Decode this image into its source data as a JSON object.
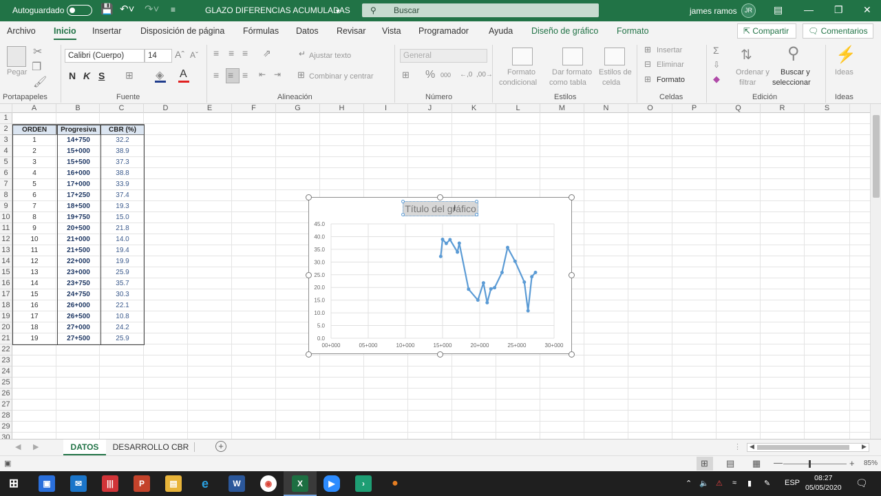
{
  "titlebar": {
    "autosave": "Autoguardado",
    "doc_title": "GLAZO DIFERENCIAS ACUMULADAS",
    "search_placeholder": "Buscar",
    "user_name": "james ramos",
    "user_initials": "JR"
  },
  "ribbon_tabs": [
    {
      "label": "Archivo"
    },
    {
      "label": "Inicio"
    },
    {
      "label": "Insertar"
    },
    {
      "label": "Disposición de página"
    },
    {
      "label": "Fórmulas"
    },
    {
      "label": "Datos"
    },
    {
      "label": "Revisar"
    },
    {
      "label": "Vista"
    },
    {
      "label": "Programador"
    },
    {
      "label": "Ayuda"
    },
    {
      "label": "Diseño de gráfico"
    },
    {
      "label": "Formato"
    }
  ],
  "share_label": "Compartir",
  "comments_label": "Comentarios",
  "ribbon": {
    "paste": "Pegar",
    "font_name": "Calibri (Cuerpo)",
    "font_size": "14",
    "bold": "N",
    "italic": "K",
    "underline": "S",
    "wrap_text": "Ajustar texto",
    "merge_center": "Combinar y centrar",
    "number_format": "General",
    "cond_format_1": "Formato",
    "cond_format_2": "condicional",
    "table_format_1": "Dar formato",
    "table_format_2": "como tabla",
    "cell_styles_1": "Estilos de",
    "cell_styles_2": "celda",
    "insert": "Insertar",
    "delete": "Eliminar",
    "format": "Formato",
    "sort_1": "Ordenar y",
    "sort_2": "filtrar",
    "find_1": "Buscar y",
    "find_2": "seleccionar",
    "ideas": "Ideas",
    "groups": {
      "clipboard": "Portapapeles",
      "font": "Fuente",
      "alignment": "Alineación",
      "number": "Número",
      "styles": "Estilos",
      "cells": "Celdas",
      "editing": "Edición",
      "ideas": "Ideas"
    }
  },
  "columns": [
    "A",
    "B",
    "C",
    "D",
    "E",
    "F",
    "G",
    "H",
    "I",
    "J",
    "K",
    "L",
    "M",
    "N",
    "O",
    "P",
    "Q",
    "R",
    "S"
  ],
  "rows": [
    "1",
    "2",
    "3",
    "4",
    "5",
    "6",
    "7",
    "8",
    "9",
    "10",
    "11",
    "12",
    "13",
    "14",
    "15",
    "16",
    "17",
    "18",
    "19",
    "20",
    "21",
    "22",
    "23",
    "24",
    "25",
    "26",
    "27",
    "28",
    "29",
    "30"
  ],
  "table": {
    "headers": [
      "ORDEN",
      "Progresiva",
      "CBR (%)"
    ],
    "rows": [
      [
        "1",
        "14+750",
        "32.2"
      ],
      [
        "2",
        "15+000",
        "38.9"
      ],
      [
        "3",
        "15+500",
        "37.3"
      ],
      [
        "4",
        "16+000",
        "38.8"
      ],
      [
        "5",
        "17+000",
        "33.9"
      ],
      [
        "6",
        "17+250",
        "37.4"
      ],
      [
        "7",
        "18+500",
        "19.3"
      ],
      [
        "8",
        "19+750",
        "15.0"
      ],
      [
        "9",
        "20+500",
        "21.8"
      ],
      [
        "10",
        "21+000",
        "14.0"
      ],
      [
        "11",
        "21+500",
        "19.4"
      ],
      [
        "12",
        "22+000",
        "19.9"
      ],
      [
        "13",
        "23+000",
        "25.9"
      ],
      [
        "14",
        "23+750",
        "35.7"
      ],
      [
        "15",
        "24+750",
        "30.3"
      ],
      [
        "16",
        "26+000",
        "22.1"
      ],
      [
        "17",
        "26+500",
        "10.8"
      ],
      [
        "18",
        "27+000",
        "24.2"
      ],
      [
        "19",
        "27+500",
        "25.9"
      ]
    ]
  },
  "chart_data": {
    "type": "scatter",
    "title": "Título del gráfico",
    "xlabel": "",
    "ylabel": "",
    "xlim": [
      0,
      30000
    ],
    "ylim": [
      0,
      45
    ],
    "x_ticks": [
      "00+000",
      "05+000",
      "10+000",
      "15+000",
      "20+000",
      "25+000",
      "30+000"
    ],
    "y_ticks": [
      "0.0",
      "5.0",
      "10.0",
      "15.0",
      "20.0",
      "25.0",
      "30.0",
      "35.0",
      "40.0",
      "45.0"
    ],
    "grid": true,
    "legend": "none",
    "series_color": "#5b9bd5",
    "x": [
      14750,
      15000,
      15500,
      16000,
      17000,
      17250,
      18500,
      19750,
      20500,
      21000,
      21500,
      22000,
      23000,
      23750,
      24750,
      26000,
      26500,
      27000,
      27500
    ],
    "y": [
      32.2,
      38.9,
      37.3,
      38.8,
      33.9,
      37.4,
      19.3,
      15.0,
      21.8,
      14.0,
      19.4,
      19.9,
      25.9,
      35.7,
      30.3,
      22.1,
      10.8,
      24.2,
      25.9
    ]
  },
  "sheet_tabs": [
    {
      "label": "DATOS"
    },
    {
      "label": "DESARROLLO CBR"
    }
  ],
  "status": {
    "zoom": "85%"
  },
  "taskbar": {
    "lang": "ESP",
    "time": "08:27",
    "date": "05/05/2020"
  }
}
